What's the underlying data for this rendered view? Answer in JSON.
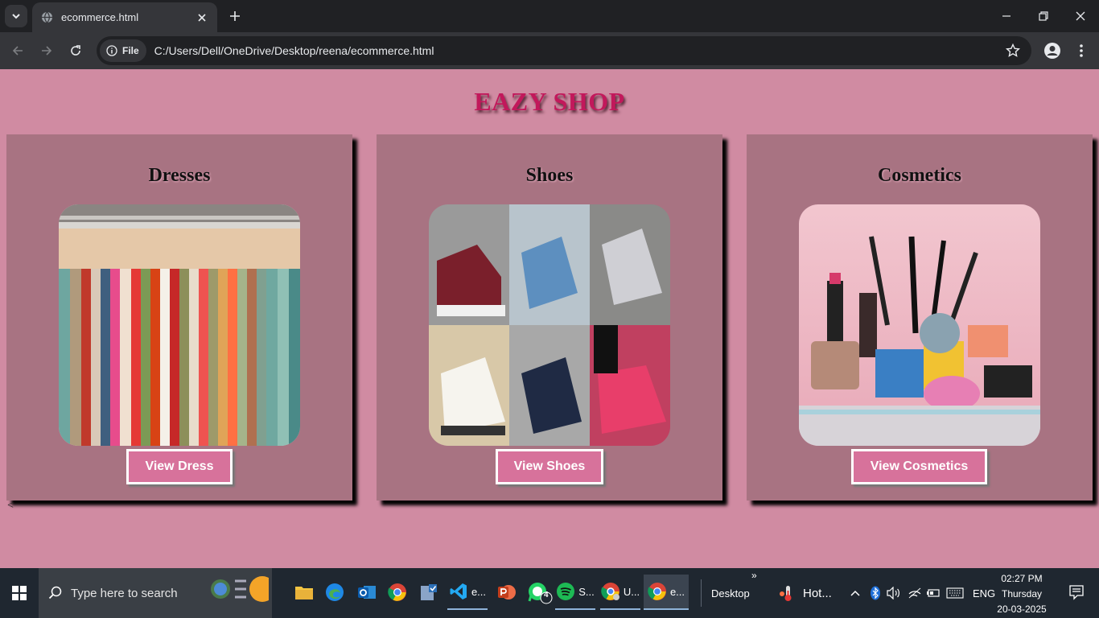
{
  "browser": {
    "tab_title": "ecommerce.html",
    "site_chip": "File",
    "url": "C:/Users/Dell/OneDrive/Desktop/reena/ecommerce.html"
  },
  "page": {
    "brand": "EAZY SHOP",
    "stray_text": "<",
    "cards": [
      {
        "title": "Dresses",
        "button": "View Dress",
        "image": "clothes-rack-photo"
      },
      {
        "title": "Shoes",
        "button": "View Shoes",
        "image": "sneakers-collage-photo"
      },
      {
        "title": "Cosmetics",
        "button": "View Cosmetics",
        "image": "makeup-products-photo"
      }
    ]
  },
  "taskbar": {
    "search_placeholder": "Type here to search",
    "apps": [
      {
        "name": "file-explorer",
        "label": ""
      },
      {
        "name": "edge",
        "label": ""
      },
      {
        "name": "outlook",
        "label": ""
      },
      {
        "name": "chrome",
        "label": ""
      },
      {
        "name": "task-app",
        "label": ""
      },
      {
        "name": "vscode",
        "label": "e..."
      },
      {
        "name": "powerpoint",
        "label": ""
      },
      {
        "name": "whatsapp",
        "label": "",
        "badge": "4"
      },
      {
        "name": "spotify",
        "label": "S..."
      },
      {
        "name": "chrome-profile",
        "label": "U..."
      },
      {
        "name": "chrome-current",
        "label": "e..."
      }
    ],
    "desktop_label": "Desktop",
    "weather": "Hot...",
    "language": "ENG",
    "time": "02:27 PM",
    "day": "Thursday",
    "date": "20-03-2025"
  }
}
